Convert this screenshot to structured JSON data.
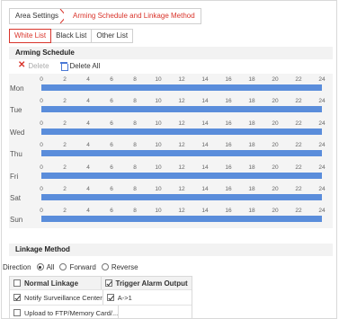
{
  "breadcrumb": {
    "area_settings": "Area Settings",
    "current": "Arming Schedule and Linkage Method"
  },
  "tabs": [
    {
      "label": "White List",
      "active": true
    },
    {
      "label": "Black List",
      "active": false
    },
    {
      "label": "Other List",
      "active": false
    }
  ],
  "schedule": {
    "title": "Arming Schedule",
    "delete_label": "Delete",
    "delete_all_label": "Delete All",
    "ticks": [
      "0",
      "2",
      "4",
      "6",
      "8",
      "10",
      "12",
      "14",
      "16",
      "18",
      "20",
      "22",
      "24"
    ],
    "days": [
      "Mon",
      "Tue",
      "Wed",
      "Thu",
      "Fri",
      "Sat",
      "Sun"
    ],
    "bar_color": "#5a8ddb"
  },
  "linkage": {
    "title": "Linkage Method",
    "direction_label": "Direction",
    "direction_options": [
      "All",
      "Forward",
      "Reverse"
    ],
    "direction_selected": "All",
    "normal_linkage_label": "Normal Linkage",
    "trigger_output_label": "Trigger Alarm Output",
    "normal_items": [
      {
        "label": "Notify Surveillance Center",
        "checked": true
      },
      {
        "label": "Upload to FTP/Memory Card/...",
        "checked": false
      }
    ],
    "outputs": [
      {
        "label": "A->1",
        "checked": true
      }
    ]
  },
  "colors": {
    "accent": "#d9342b",
    "bar": "#5a8ddb"
  }
}
